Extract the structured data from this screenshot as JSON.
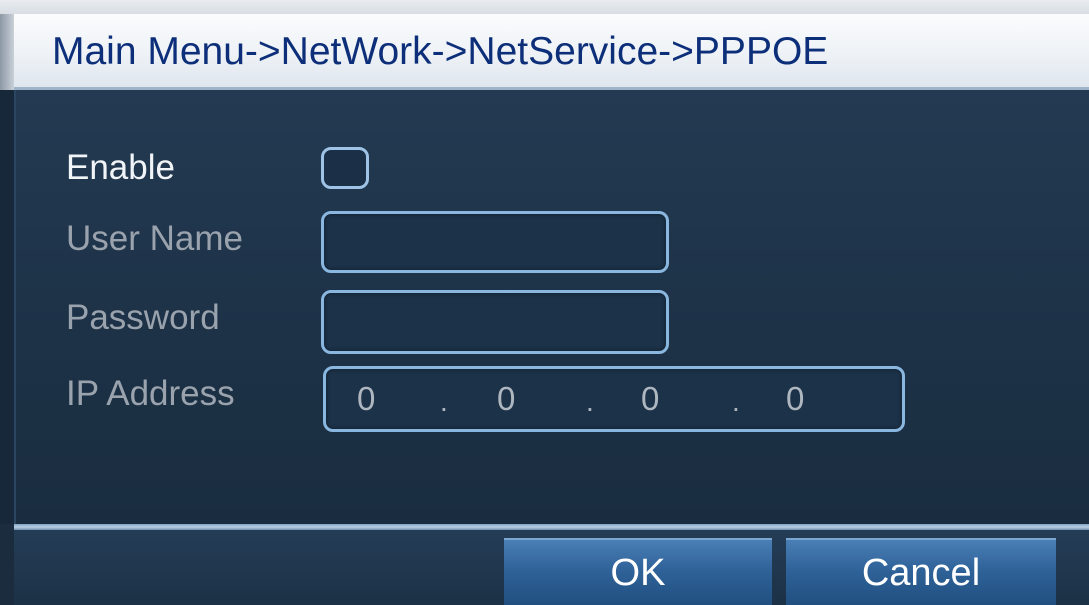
{
  "window": {
    "breadcrumb": "Main Menu->NetWork->NetService->PPPOE"
  },
  "form": {
    "enable": {
      "label": "Enable",
      "checked": false
    },
    "username": {
      "label": "User Name",
      "value": ""
    },
    "password": {
      "label": "Password",
      "value": ""
    },
    "ip_address": {
      "label": "IP Address",
      "octets": [
        "0",
        "0",
        "0",
        "0"
      ],
      "separator": "."
    }
  },
  "buttons": {
    "ok": "OK",
    "cancel": "Cancel"
  },
  "colors": {
    "title_text": "#0d2f7a",
    "panel_bg": "#1d3247",
    "field_border": "#8ab7e0",
    "button_blue": "#2f6399"
  }
}
